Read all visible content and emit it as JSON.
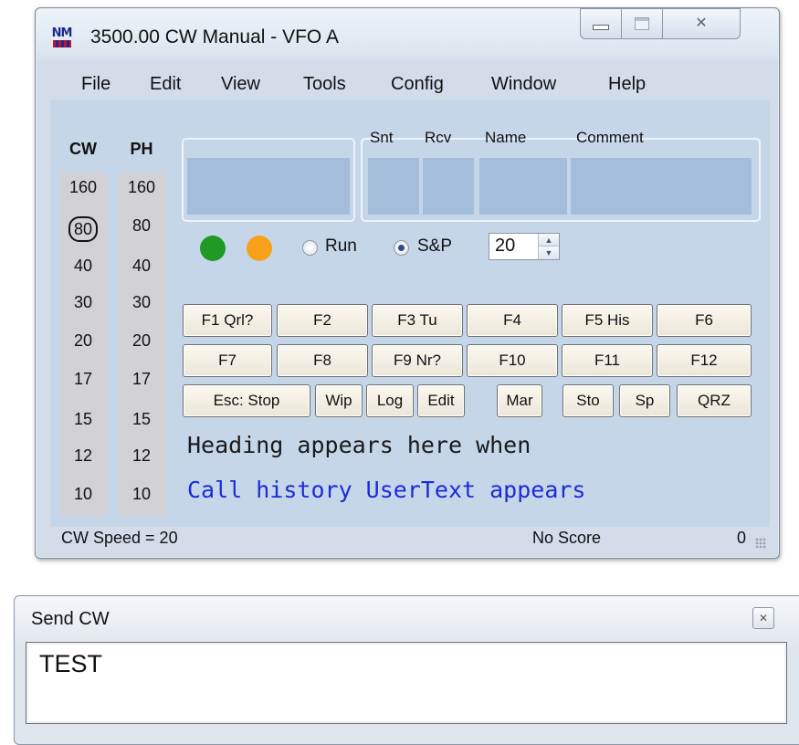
{
  "window": {
    "title": "3500.00 CW Manual - VFO A",
    "logo_text": "NM",
    "controls": {
      "minimize": "minimize-icon",
      "maximize": "maximize-icon",
      "close": "close-icon"
    }
  },
  "menu": {
    "items": [
      "File",
      "Edit",
      "View",
      "Tools",
      "Config",
      "Window",
      "Help"
    ]
  },
  "bands": {
    "cw_header": "CW",
    "ph_header": "PH",
    "cw": [
      "160",
      "80",
      "40",
      "30",
      "20",
      "17",
      "15",
      "12",
      "10"
    ],
    "ph": [
      "160",
      "80",
      "40",
      "30",
      "20",
      "17",
      "15",
      "12",
      "10"
    ],
    "active_cw": "80"
  },
  "entry": {
    "labels": {
      "snt": "Snt",
      "rcv": "Rcv",
      "name": "Name",
      "comment": "Comment"
    },
    "call_value": "",
    "snt_value": "",
    "rcv_value": "",
    "name_value": "",
    "comment_value": ""
  },
  "indicators": {
    "green": "#1e9a25",
    "orange": "#f7a11a"
  },
  "mode": {
    "run_label": "Run",
    "sp_label": "S&P",
    "selected": "S&P"
  },
  "speed_spinner": {
    "value": "20"
  },
  "function_keys": {
    "row1": [
      "F1 Qrl?",
      "F2",
      "F3 Tu",
      "F4",
      "F5 His",
      "F6"
    ],
    "row2": [
      "F7",
      "F8",
      "F9 Nr?",
      "F10",
      "F11",
      "F12"
    ],
    "row3": [
      "Esc: Stop",
      "Wip",
      "Log",
      "Edit",
      "Mar",
      "Sto",
      "Sp",
      "QRZ"
    ]
  },
  "info": {
    "heading": "Heading appears here when",
    "history": "Call history UserText appears"
  },
  "status": {
    "speed": "CW Speed = 20",
    "score": "No Score",
    "count": "0"
  },
  "send_cw": {
    "title": "Send CW",
    "text": "TEST"
  },
  "colors": {
    "client_bg": "#c6d6e9",
    "field_fill": "#a3bddb",
    "band_strip": "#d2d2d5",
    "history_text": "#1c2bd8"
  }
}
